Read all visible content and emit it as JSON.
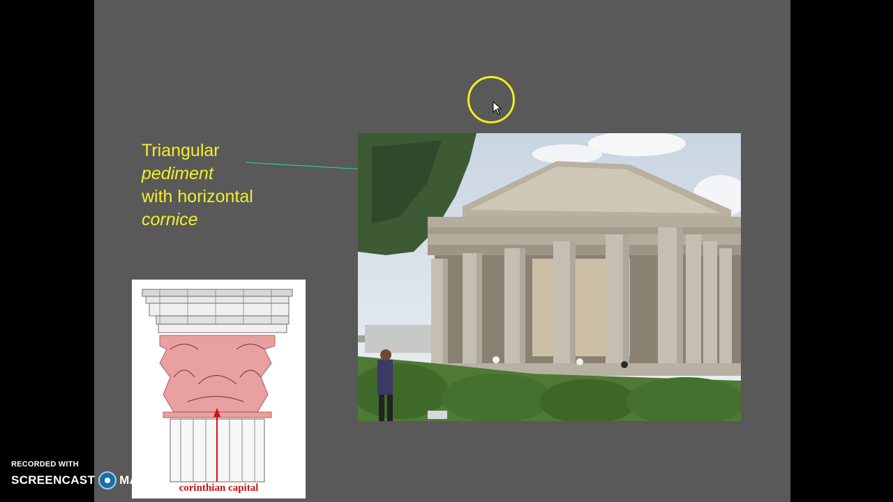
{
  "slide": {
    "text_lines": [
      {
        "text": "Triangular"
      },
      {
        "text": "pediment"
      },
      {
        "text": "with horizontal"
      },
      {
        "text": "cornice"
      }
    ],
    "capital_label": "corinthian capital"
  },
  "watermark": {
    "recorded_with": "RECORDED WITH",
    "brand_left": "SCREENCAST",
    "brand_right": "MATIC"
  },
  "colors": {
    "slide_bg": "#595959",
    "text": "#f0f02a",
    "arrow": "#2ec9a0",
    "cursor_ring": "#f2ee1b",
    "capital_label": "#d01010"
  },
  "icons": {
    "cursor": "mouse-pointer-icon",
    "highlight": "cursor-highlight-ring-icon",
    "logo": "screencastomatic-logo-icon"
  }
}
